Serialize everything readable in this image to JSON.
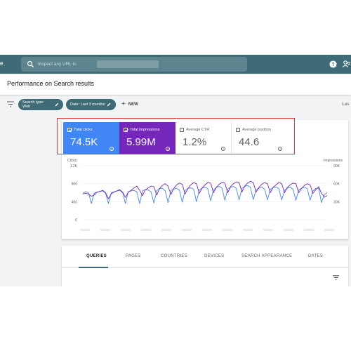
{
  "header": {
    "brand_fragment": "e",
    "search_placeholder": "Inspect any URL in"
  },
  "page": {
    "title": "Performance on Search results"
  },
  "filters": {
    "chips": [
      "Search type: Web",
      "Date: Last 3 months"
    ],
    "new_label": "NEW",
    "right_fragment": "Las"
  },
  "metrics": [
    {
      "label": "Total clicks",
      "value": "74.5K",
      "selected": true,
      "color": "#4285f4"
    },
    {
      "label": "Total impressions",
      "value": "5.99M",
      "selected": true,
      "color": "#7627bb"
    },
    {
      "label": "Average CTR",
      "value": "1.2%",
      "selected": false
    },
    {
      "label": "Average position",
      "value": "44.6",
      "selected": false
    }
  ],
  "chart_data": {
    "type": "line",
    "y_left_label": "Clicks",
    "y_right_label": "Impressions",
    "y_left_ticks": [
      "1.2K",
      "800",
      "400",
      "0"
    ],
    "y_right_ticks": [
      "90K",
      "60K",
      "30K"
    ],
    "ylim_left": [
      0,
      1200
    ],
    "ylim_right": [
      0,
      90000
    ],
    "series": [
      {
        "name": "Clicks",
        "color": "#4285f4",
        "axis": "left",
        "values": [
          590,
          620,
          600,
          360,
          590,
          610,
          630,
          640,
          590,
          360,
          600,
          620,
          640,
          650,
          600,
          360,
          620,
          640,
          650,
          620,
          360,
          640,
          670,
          660,
          620,
          370,
          640,
          690,
          700,
          640,
          380,
          650,
          680,
          700,
          660,
          390,
          650,
          690,
          710,
          680,
          400,
          660,
          700,
          720,
          690,
          420,
          660,
          720,
          740,
          700,
          430,
          680,
          720,
          740,
          700,
          440,
          700,
          740,
          760,
          720,
          450,
          660,
          700,
          720,
          680,
          440,
          670,
          710,
          730,
          690,
          440,
          660,
          700,
          720,
          680,
          430,
          660,
          700,
          720,
          690,
          430,
          640,
          690,
          700,
          380,
          560,
          600
        ]
      },
      {
        "name": "Impressions",
        "color": "#7627bb",
        "axis": "right",
        "values": [
          43000,
          44000,
          43000,
          39000,
          41000,
          46000,
          47000,
          49000,
          45000,
          35000,
          43000,
          46000,
          48000,
          50000,
          46000,
          37000,
          46000,
          49000,
          53000,
          56000,
          49000,
          40000,
          50000,
          53000,
          56000,
          55000,
          41000,
          52000,
          57000,
          60000,
          56000,
          42000,
          52000,
          58000,
          61000,
          59000,
          43000,
          52000,
          58000,
          62000,
          60000,
          44000,
          53000,
          58000,
          62000,
          61000,
          45000,
          54000,
          59000,
          62000,
          61000,
          45000,
          55000,
          60000,
          63000,
          62000,
          46000,
          56000,
          61000,
          64000,
          62000,
          46000,
          54000,
          59000,
          62000,
          60000,
          45000,
          54000,
          58000,
          62000,
          60000,
          45000,
          54000,
          58000,
          61000,
          60000,
          45000,
          52000,
          57000,
          60000,
          58000,
          44000,
          50000,
          55000,
          44000,
          38000,
          40000
        ]
      }
    ]
  },
  "tabs": {
    "items": [
      "QUERIES",
      "PAGES",
      "COUNTRIES",
      "DEVICES",
      "SEARCH APPEARANCE",
      "DATES"
    ],
    "active": "QUERIES"
  }
}
